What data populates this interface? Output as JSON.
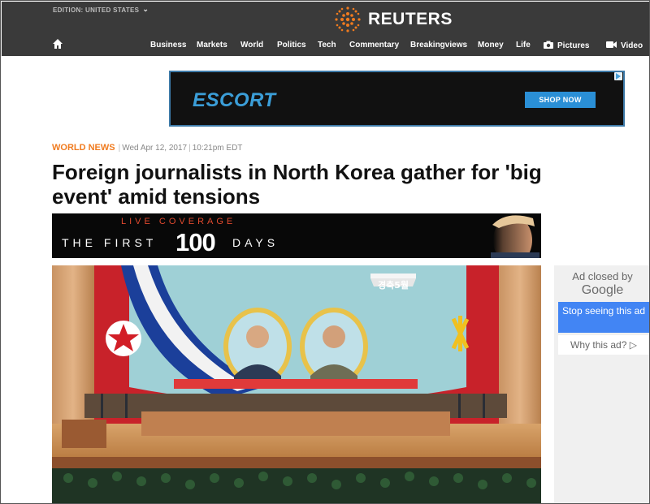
{
  "header": {
    "edition": "EDITION: UNITED STATES",
    "brand": "REUTERS",
    "nav": [
      {
        "label": "Business"
      },
      {
        "label": "Markets"
      },
      {
        "label": "World"
      },
      {
        "label": "Politics"
      },
      {
        "label": "Tech"
      },
      {
        "label": "Commentary"
      },
      {
        "label": "Breakingviews"
      },
      {
        "label": "Money"
      },
      {
        "label": "Life"
      },
      {
        "label": "Pictures",
        "icon": "camera-icon"
      },
      {
        "label": "Video",
        "icon": "video-camera-icon"
      }
    ]
  },
  "ad_banner": {
    "brand": "ESCORT",
    "cta": "SHOP NOW"
  },
  "article": {
    "category": "WORLD NEWS",
    "date": "Wed Apr 12, 2017",
    "time": "10:21pm EDT",
    "headline": "Foreign journalists in North Korea gather for 'big event' amid tensions"
  },
  "live_banner": {
    "top": "LIVE COVERAGE",
    "first": "THE FIRST",
    "number": "100",
    "days": "DAYS"
  },
  "photo": {
    "sign_text": "경축5월"
  },
  "side_ad": {
    "closed_by": "Ad closed by",
    "provider": "Google",
    "stop_label": "Stop seeing this ad",
    "why_label": "Why this ad? ▷"
  },
  "colors": {
    "header_bg": "#3a3a3a",
    "reuters_orange": "#f07b1f",
    "ad_blue": "#2a8fd6",
    "google_blue": "#4285f4"
  }
}
